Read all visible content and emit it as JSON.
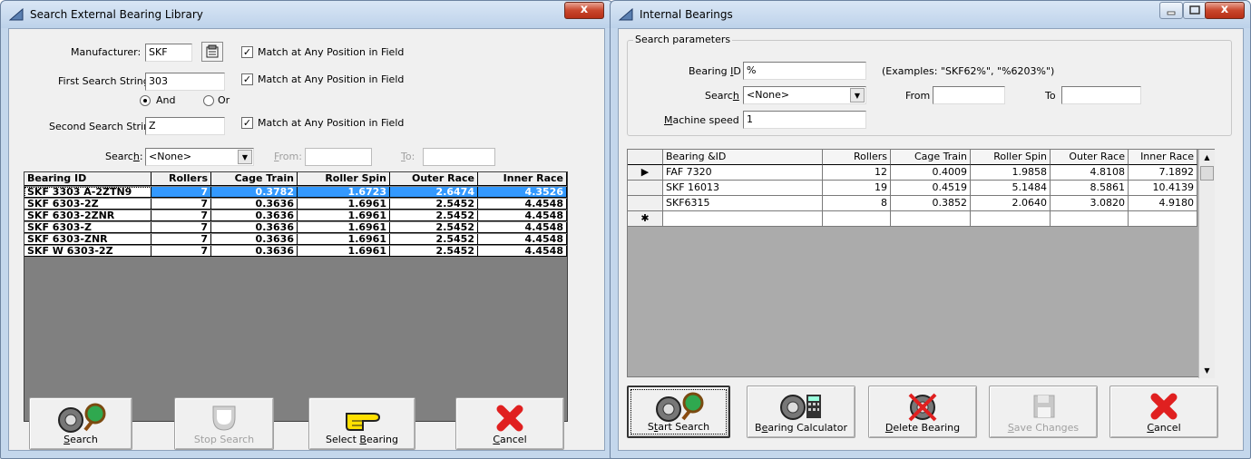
{
  "left_window": {
    "title": "Search External Bearing Library",
    "close_label": "x",
    "manufacturer_label": "Manufacturer:",
    "manufacturer_value": "SKF",
    "first_search_label": "First Search String:",
    "first_search_value": "303",
    "second_search_label": "Second Search String:",
    "second_search_value": "Z",
    "match_label": "Match at Any Position in Field",
    "check_mark": "✓",
    "and_label": "And",
    "or_label": "Or",
    "search_label_pre": "Searc",
    "search_label_u": "h",
    "search_label_post": ":",
    "search_value": "<None>",
    "from_label_u": "F",
    "from_label_post": "rom:",
    "to_label_u": "T",
    "to_label_post": "o:",
    "grid": {
      "headers": [
        "Bearing ID",
        "Rollers",
        "Cage Train",
        "Roller Spin",
        "Outer Race",
        "Inner Race"
      ],
      "rows": [
        [
          "SKF 3303 A-2ZTN9",
          "7",
          "0.3782",
          "1.6723",
          "2.6474",
          "4.3526"
        ],
        [
          "SKF 6303-2Z",
          "7",
          "0.3636",
          "1.6961",
          "2.5452",
          "4.4548"
        ],
        [
          "SKF 6303-2ZNR",
          "7",
          "0.3636",
          "1.6961",
          "2.5452",
          "4.4548"
        ],
        [
          "SKF 6303-Z",
          "7",
          "0.3636",
          "1.6961",
          "2.5452",
          "4.4548"
        ],
        [
          "SKF 6303-ZNR",
          "7",
          "0.3636",
          "1.6961",
          "2.5452",
          "4.4548"
        ],
        [
          "SKF W 6303-2Z",
          "7",
          "0.3636",
          "1.6961",
          "2.5452",
          "4.4548"
        ]
      ]
    },
    "buttons": {
      "search_u": "S",
      "search_post": "earch",
      "stop_search": "Stop Search",
      "select_bearing_pre": "Select ",
      "select_bearing_u": "B",
      "select_bearing_post": "earing",
      "cancel_u": "C",
      "cancel_post": "ancel"
    }
  },
  "right_window": {
    "title": "Internal Bearings",
    "close_label": "x",
    "group_label": "Search parameters",
    "bearing_id_label_pre": "Bearing ",
    "bearing_id_label_u": "I",
    "bearing_id_label_post": "D",
    "bearing_id_value": "%",
    "examples_text": "(Examples: \"SKF62%\", \"%6203%\")",
    "search_label_pre": "Searc",
    "search_label_u": "h",
    "search_value": "<None>",
    "from_label": "From",
    "to_label": "To",
    "machine_speed_label_u": "M",
    "machine_speed_label_post": "achine speed",
    "machine_speed_value": "1",
    "grid": {
      "headers": [
        "Bearing &ID",
        "Rollers",
        "Cage Train",
        "Roller Spin",
        "Outer Race",
        "Inner Race"
      ],
      "rows": [
        [
          "FAF 7320",
          "12",
          "0.4009",
          "1.9858",
          "4.8108",
          "7.1892"
        ],
        [
          "SKF 16013",
          "19",
          "0.4519",
          "5.1484",
          "8.5861",
          "10.4139"
        ],
        [
          "SKF6315",
          "8",
          "0.3852",
          "2.0640",
          "3.0820",
          "4.9180"
        ]
      ],
      "current_row_marker": "▶",
      "new_row_marker": "✱"
    },
    "buttons": {
      "start_search_pre": "S",
      "start_search_u": "t",
      "start_search_post": "art Search",
      "bearing_calc_pre": "B",
      "bearing_calc_u": "e",
      "bearing_calc_post": "aring Calculator",
      "delete_u": "D",
      "delete_post": "elete Bearing",
      "save_u": "S",
      "save_post": "ave Changes",
      "cancel_u": "C",
      "cancel_post": "ancel"
    }
  },
  "colors": {
    "selection": "#3399ff",
    "cancel_red": "#e02020",
    "hand_yellow": "#ffe000"
  }
}
